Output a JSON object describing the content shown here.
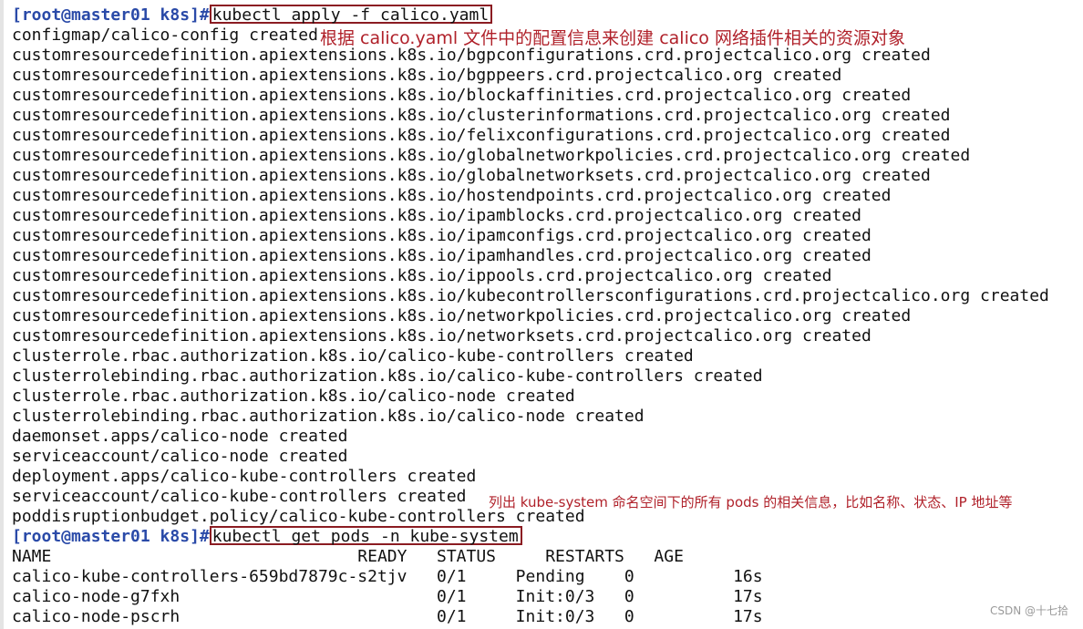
{
  "prompt": "[root@master01 k8s]#",
  "commands": {
    "apply": "kubectl apply -f calico.yaml",
    "get_pods": "kubectl get pods -n kube-system"
  },
  "apply_output": [
    "configmap/calico-config created",
    "customresourcedefinition.apiextensions.k8s.io/bgpconfigurations.crd.projectcalico.org created",
    "customresourcedefinition.apiextensions.k8s.io/bgppeers.crd.projectcalico.org created",
    "customresourcedefinition.apiextensions.k8s.io/blockaffinities.crd.projectcalico.org created",
    "customresourcedefinition.apiextensions.k8s.io/clusterinformations.crd.projectcalico.org created",
    "customresourcedefinition.apiextensions.k8s.io/felixconfigurations.crd.projectcalico.org created",
    "customresourcedefinition.apiextensions.k8s.io/globalnetworkpolicies.crd.projectcalico.org created",
    "customresourcedefinition.apiextensions.k8s.io/globalnetworksets.crd.projectcalico.org created",
    "customresourcedefinition.apiextensions.k8s.io/hostendpoints.crd.projectcalico.org created",
    "customresourcedefinition.apiextensions.k8s.io/ipamblocks.crd.projectcalico.org created",
    "customresourcedefinition.apiextensions.k8s.io/ipamconfigs.crd.projectcalico.org created",
    "customresourcedefinition.apiextensions.k8s.io/ipamhandles.crd.projectcalico.org created",
    "customresourcedefinition.apiextensions.k8s.io/ippools.crd.projectcalico.org created",
    "customresourcedefinition.apiextensions.k8s.io/kubecontrollersconfigurations.crd.projectcalico.org created",
    "customresourcedefinition.apiextensions.k8s.io/networkpolicies.crd.projectcalico.org created",
    "customresourcedefinition.apiextensions.k8s.io/networksets.crd.projectcalico.org created",
    "clusterrole.rbac.authorization.k8s.io/calico-kube-controllers created",
    "clusterrolebinding.rbac.authorization.k8s.io/calico-kube-controllers created",
    "clusterrole.rbac.authorization.k8s.io/calico-node created",
    "clusterrolebinding.rbac.authorization.k8s.io/calico-node created",
    "daemonset.apps/calico-node created",
    "serviceaccount/calico-node created",
    "deployment.apps/calico-kube-controllers created",
    "serviceaccount/calico-kube-controllers created",
    "poddisruptionbudget.policy/calico-kube-controllers created"
  ],
  "pods_table": {
    "header": "NAME                               READY   STATUS     RESTARTS   AGE",
    "rows": [
      "calico-kube-controllers-659bd7879c-s2tjv   0/1     Pending    0          16s",
      "calico-node-g7fxh                          0/1     Init:0/3   0          17s",
      "calico-node-pscrh                          0/1     Init:0/3   0          17s"
    ]
  },
  "annotations": {
    "apply_note": "根据 calico.yaml 文件中的配置信息来创建 calico 网络插件相关的资源对象",
    "get_pods_note": "列出 kube-system 命名空间下的所有 pods 的相关信息，比如名称、状态、IP 地址等"
  },
  "watermark": "CSDN @十七拾",
  "colors": {
    "prompt": "#2a4aa8",
    "annotation": "#b0212a",
    "box_border": "#8b1c22",
    "text": "#111111"
  }
}
